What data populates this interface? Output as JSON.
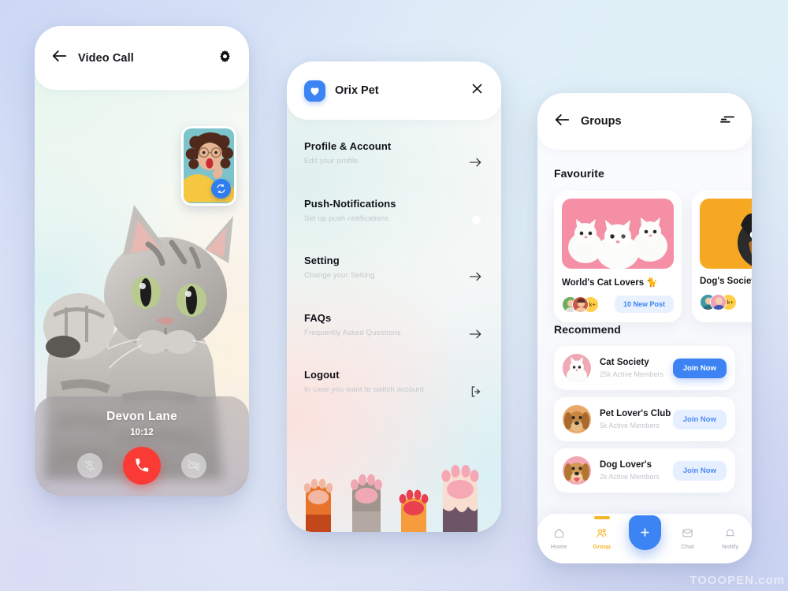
{
  "phone_video_call": {
    "header": {
      "title": "Video Call",
      "back_icon": "arrow-left-icon",
      "settings_icon": "gear-icon"
    },
    "pip": {
      "flip_icon": "camera-flip-icon"
    },
    "call": {
      "caller_name": "Devon Lane",
      "duration": "10:12",
      "mute_icon": "microphone-off-icon",
      "end_icon": "phone-icon",
      "video_off_icon": "video-off-icon",
      "end_color": "#fa3b35"
    }
  },
  "phone_menu": {
    "header": {
      "brand": "Orix Pet",
      "logo_icon": "pet-heart-logo-icon",
      "close_icon": "close-icon",
      "logo_color": "#3c84f3"
    },
    "items": [
      {
        "title": "Profile & Account",
        "subtitle": "Edit your profile",
        "action": "arrow-right-icon"
      },
      {
        "title": "Push-Notifications",
        "subtitle": "Set up push notifications",
        "action": "toggle",
        "toggle_on": true,
        "toggle_color": "#ffd83b"
      },
      {
        "title": "Setting",
        "subtitle": "Change your Setting",
        "action": "arrow-right-icon"
      },
      {
        "title": "FAQs",
        "subtitle": "Frequently Asked Questions",
        "action": "arrow-right-icon"
      },
      {
        "title": "Logout",
        "subtitle": "In case you want to switch account",
        "action": "logout-icon"
      }
    ],
    "decoration": "cat-paws-illustration"
  },
  "phone_groups": {
    "header": {
      "title": "Groups",
      "back_icon": "arrow-left-icon",
      "filter_icon": "filter-icon"
    },
    "favourite": {
      "section_title": "Favourite",
      "cards": [
        {
          "name": "World's Cat Lovers 🐈",
          "member_count": "1k+",
          "badge": "10 New Post",
          "image": "white-kittens-pink-background"
        },
        {
          "name": "Dog's Society",
          "member_count": "2k+",
          "badge": "",
          "image": "dog-yellow-background"
        }
      ]
    },
    "recommend": {
      "section_title": "Recommend",
      "items": [
        {
          "name": "Cat Society",
          "members": "25k Active Members",
          "cta": "Join Now",
          "primary": true,
          "avatar": "white-cat-avatar"
        },
        {
          "name": "Pet Lover's Club",
          "members": "5k Active Members",
          "cta": "Join Now",
          "primary": false,
          "avatar": "golden-dog-avatar"
        },
        {
          "name": "Dog Lover's",
          "members": "2k Active Members",
          "cta": "Join Now",
          "primary": false,
          "avatar": "happy-dog-avatar"
        }
      ]
    },
    "bottom_nav": {
      "items": [
        {
          "label": "Home",
          "icon": "home-icon",
          "active": false
        },
        {
          "label": "Group",
          "icon": "group-icon",
          "active": true
        },
        {
          "label": "Chat",
          "icon": "mail-icon",
          "active": false
        },
        {
          "label": "Notify",
          "icon": "bell-icon",
          "active": false
        }
      ],
      "fab_icon": "plus-icon",
      "active_color": "#f7b62a",
      "fab_color": "#3c84f3"
    }
  },
  "watermark": {
    "text": "TOOOPEN.com"
  }
}
